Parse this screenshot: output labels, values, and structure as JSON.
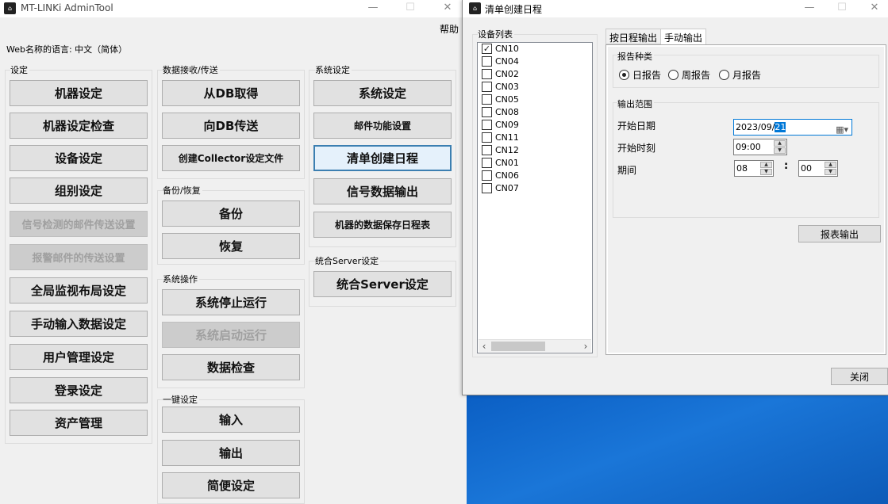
{
  "main_window": {
    "title": "MT-LINKi AdminTool",
    "icon": "app-icon",
    "controls": {
      "minimize": "—",
      "maximize": "☐",
      "close": "✕"
    },
    "menu": {
      "help": "帮助"
    },
    "web_language": "Web名称的语言: 中文（简体）",
    "groups": {
      "settings": {
        "label": "设定",
        "buttons": [
          "机器设定",
          "机器设定检查",
          "设备设定",
          "组别设定",
          "信号检测的邮件传送设置",
          "报警邮件的传送设置",
          "全局监视布局设定",
          "手动输入数据设定",
          "用户管理设定",
          "登录设定",
          "资产管理"
        ]
      },
      "data_transfer": {
        "label": "数据接收/传送",
        "buttons": [
          "从DB取得",
          "向DB传送",
          "创建Collector设定文件"
        ]
      },
      "backup": {
        "label": "备份/恢复",
        "buttons": [
          "备份",
          "恢复"
        ]
      },
      "system_ops": {
        "label": "系统操作",
        "buttons": [
          "系统停止运行",
          "系统启动运行",
          "数据检查"
        ]
      },
      "one_click": {
        "label": "一键设定",
        "buttons": [
          "输入",
          "输出",
          "简便设定"
        ]
      },
      "system_settings": {
        "label": "系统设定",
        "buttons": [
          "系统设定",
          "邮件功能设置",
          "清单创建日程",
          "信号数据输出",
          "机器的数据保存日程表"
        ]
      },
      "server": {
        "label": "统合Server设定",
        "buttons": [
          "统合Server设定"
        ]
      }
    }
  },
  "dialog": {
    "title": "清单创建日程",
    "icon": "app-icon",
    "controls": {
      "minimize": "—",
      "maximize": "☐",
      "close": "✕"
    },
    "device_list": {
      "label": "设备列表",
      "items": [
        {
          "name": "CN10",
          "checked": true
        },
        {
          "name": "CN04",
          "checked": false
        },
        {
          "name": "CN02",
          "checked": false
        },
        {
          "name": "CN03",
          "checked": false
        },
        {
          "name": "CN05",
          "checked": false
        },
        {
          "name": "CN08",
          "checked": false
        },
        {
          "name": "CN09",
          "checked": false
        },
        {
          "name": "CN11",
          "checked": false
        },
        {
          "name": "CN12",
          "checked": false
        },
        {
          "name": "CN01",
          "checked": false
        },
        {
          "name": "CN06",
          "checked": false
        },
        {
          "name": "CN07",
          "checked": false
        }
      ],
      "scroll_left": "‹",
      "scroll_right": "›"
    },
    "tabs": [
      {
        "label": "按日程输出",
        "active": false
      },
      {
        "label": "手动输出",
        "active": true
      }
    ],
    "report_type": {
      "label": "报告种类",
      "options": [
        {
          "label": "日报告",
          "selected": true
        },
        {
          "label": "周报告",
          "selected": false
        },
        {
          "label": "月报告",
          "selected": false
        }
      ]
    },
    "output_range": {
      "label": "输出范围",
      "start_date_label": "开始日期",
      "start_date_prefix": "2023/09/",
      "start_date_day": "21",
      "start_time_label": "开始时刻",
      "start_time": "09:00",
      "period_label": "期间",
      "period_hours": "08",
      "period_sep": ":",
      "period_minutes": "00"
    },
    "report_output_button": "报表输出",
    "close_button": "关闭"
  }
}
